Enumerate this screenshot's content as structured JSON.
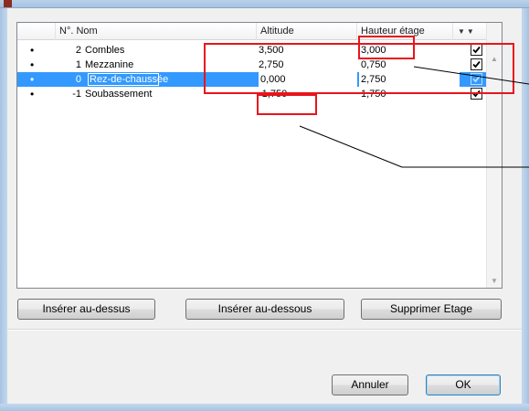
{
  "columns": {
    "num": "N°.",
    "nom": "Nom",
    "altitude": "Altitude",
    "hauteur": "Hauteur étage",
    "sort_glyph": "▼▼"
  },
  "rows": [
    {
      "bullet": "•",
      "num": "2",
      "nom": "Combles",
      "altitude": "3,500",
      "hauteur": "3,000",
      "checked": true,
      "selected": false
    },
    {
      "bullet": "•",
      "num": "1",
      "nom": "Mezzanine",
      "altitude": "2,750",
      "hauteur": "0,750",
      "checked": true,
      "selected": false
    },
    {
      "bullet": "•",
      "num": "0",
      "nom": "Rez-de-chaussée",
      "altitude": "0,000",
      "hauteur": "2,750",
      "checked": true,
      "selected": true
    },
    {
      "bullet": "•",
      "num": "-1",
      "nom": "Soubassement",
      "altitude": "-1,750",
      "hauteur": "1,750",
      "checked": true,
      "selected": false
    }
  ],
  "buttons": {
    "insert_above": "Insérer au-dessus",
    "insert_below": "Insérer au-dessous",
    "delete_floor": "Supprimer Etage",
    "cancel": "Annuler",
    "ok": "OK"
  },
  "colors": {
    "selection": "#3399ff",
    "annotation": "#e8141c"
  }
}
